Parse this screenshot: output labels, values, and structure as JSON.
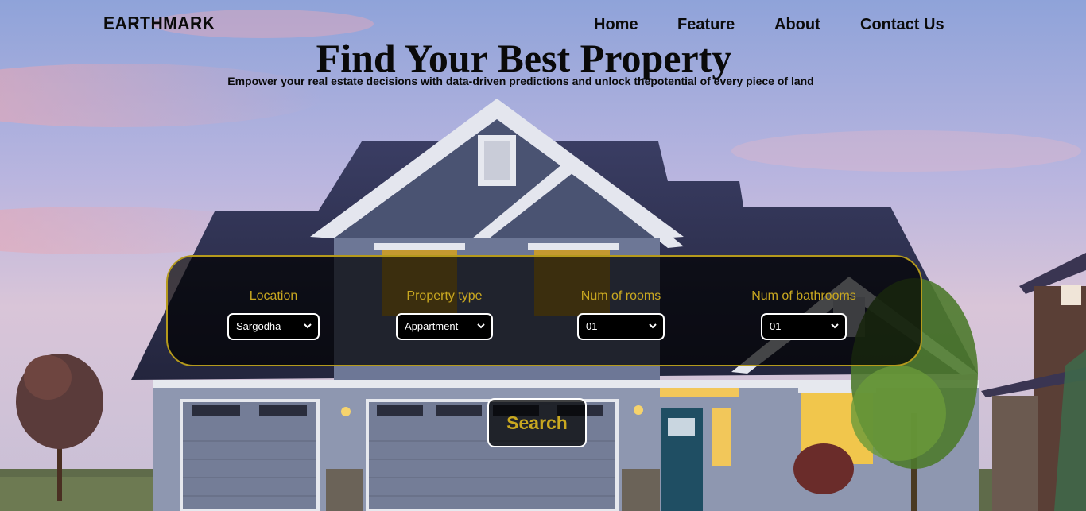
{
  "brand": "EARTHMARK",
  "nav": {
    "home": "Home",
    "feature": "Feature",
    "about": "About",
    "contact": "Contact Us"
  },
  "hero": {
    "title": "Find Your Best Property",
    "subtitle": "Empower your real estate decisions with data-driven predictions and unlock thepotential of every piece of land"
  },
  "filters": {
    "location": {
      "label": "Location",
      "value": "Sargodha"
    },
    "property_type": {
      "label": "Property type",
      "value": "Appartment"
    },
    "rooms": {
      "label": "Num of rooms",
      "value": "01"
    },
    "bathrooms": {
      "label": "Num of bathrooms",
      "value": "01"
    }
  },
  "search_label": "Search",
  "colors": {
    "accent": "#c9a820",
    "panel_border": "#b59a1c",
    "panel_bg": "rgba(0,0,0,0.70)"
  },
  "icons": {
    "select_arrow": "chevron-down-icon"
  }
}
